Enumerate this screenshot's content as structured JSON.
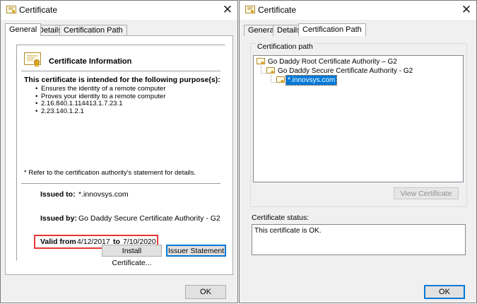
{
  "left_dialog": {
    "title": "Certificate",
    "tabs": [
      "General",
      "Details",
      "Certification Path"
    ],
    "info_title": "Certificate Information",
    "purpose_heading": "This certificate is intended for the following purpose(s):",
    "purposes": [
      "Ensures the identity of a remote computer",
      "Proves your identity to a remote computer",
      "2.16.840.1.114413.1.7.23.1",
      "2.23.140.1.2.1"
    ],
    "refer_note": "* Refer to the certification authority's statement for details.",
    "issued_to_label": "Issued to:",
    "issued_to_value": "*.innovsys.com",
    "issued_by_label": "Issued by:",
    "issued_by_value": "Go Daddy Secure Certificate Authority - G2",
    "valid_from_label": "Valid from",
    "valid_from_value": "4/12/2017",
    "valid_to_label": "to",
    "valid_to_value": "7/10/2020",
    "install_button": "Install Certificate...",
    "issuer_button": "Issuer Statement",
    "ok_button": "OK"
  },
  "right_dialog": {
    "title": "Certificate",
    "tabs": [
      "General",
      "Details",
      "Certification Path"
    ],
    "path_label": "Certification path",
    "path_items": [
      "Go Daddy Root Certificate Authority – G2",
      "Go Daddy Secure Certificate Authority - G2",
      "*.innovsys.com"
    ],
    "view_button": "View Certificate",
    "status_label": "Certificate status:",
    "status_text": "This certificate is OK.",
    "ok_button": "OK"
  },
  "colors": {
    "accent": "#0078d7",
    "highlight_border": "#e53935",
    "window_bg": "#f0f0f0"
  }
}
